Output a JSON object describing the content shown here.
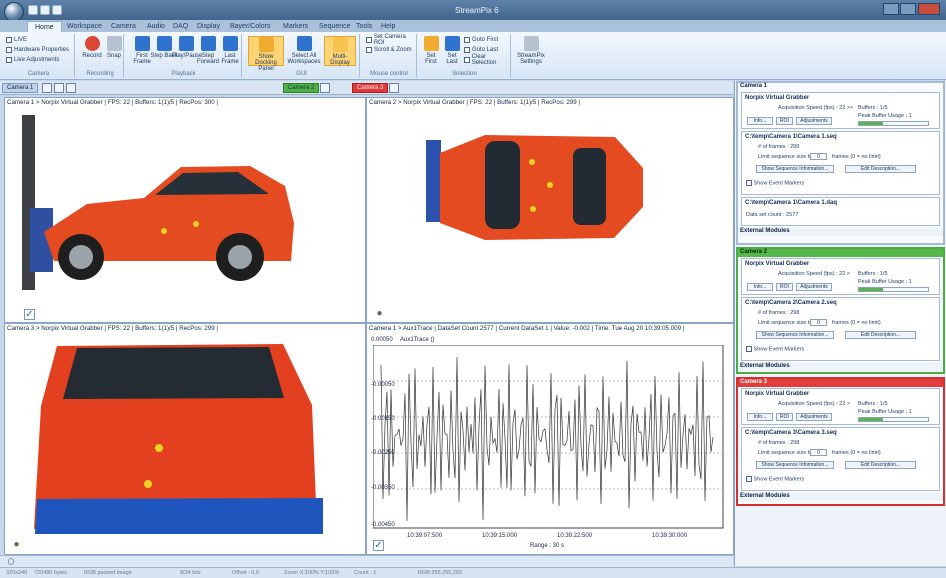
{
  "window": {
    "title": "StreamPix 6"
  },
  "tabs": [
    "Home",
    "Workspace",
    "Camera",
    "Audio",
    "DAQ",
    "Display",
    "Bayer/Colors",
    "Markers",
    "Sequence",
    "Tools",
    "Help"
  ],
  "ribbon": {
    "camera": {
      "label": "Camera",
      "live": "LIVE",
      "hardware": "Hardware Properties",
      "adjust": "Live Adjustments"
    },
    "recording": {
      "label": "Recording",
      "record": "Record",
      "snap": "Snap"
    },
    "playback": {
      "label": "Playback",
      "first": "First Frame",
      "stepback": "Step Back",
      "play": "Play/Pause",
      "stepfwd": "Step Forward",
      "last": "Last Frame"
    },
    "gui": {
      "label": "GUI",
      "docking": "Show Docking Panel",
      "selectall": "Select All Workspaces",
      "multi": "Multi-Display"
    },
    "mouse": {
      "label": "Mouse control",
      "roi": "Set Camera ROI",
      "scroll": "Scroll & Zoom"
    },
    "selection": {
      "label": "Selection",
      "setfirst": "Set First",
      "setlast": "Set Last",
      "gofirst": "Goto First",
      "golast": "Goto Last",
      "clear": "Clear Selection"
    },
    "settings": {
      "label": "StreamPix Settings"
    }
  },
  "tool": {
    "cam1": "Camera 1",
    "cam2": "Camera 2",
    "cam3": "Camera 3"
  },
  "views": {
    "v1": "Camera 1 > Norpix Virtual Grabber | FPS: 22 | Buffers: 1(1)/5 | RecPos: 300 |",
    "v2": "Camera 2 > Norpix Virtual Grabber | FPS: 22 | Buffers: 1(1)/5 | RecPos: 299 |",
    "v3": "Camera 3 > Norpix Virtual Grabber | FPS: 22 | Buffers: 1(1)/5 | RecPos: 299 |",
    "v4": "Camera 1 > Aux1Trace | DataSet Count 2577 | Current DataSet 1 | Value: -0.002 | Time: Tue Aug 20 10:39:05.009 |",
    "plot": {
      "ytop": "0.00050",
      "series": "Aux1Trace ()",
      "ylabels": [
        "-0.00050",
        "-0.00150",
        "-0.00250",
        "-0.00350",
        "-0.00450"
      ],
      "xlabels": [
        "10:39:07:500",
        "10:39:15:000",
        "10:39:22:500",
        "10:39:30:000"
      ],
      "range": "Range : 30 s"
    }
  },
  "panel": {
    "c1": {
      "title": "Camera 1",
      "grabber": "Norpix Virtual Grabber",
      "speed": "Acquisition Speed (fps) : 22 >>",
      "buffers": "Buffers : 1/5",
      "peak": "Peak Buffer Usage : 1",
      "peakfill": 0.35,
      "seq": "C:\\temp\\Camera 1\\Camera 1.seq",
      "frames": "# of frames : 299",
      "limit": "Limit sequence size to:",
      "limitval": "0",
      "limithint": "frames (0 = no limit)",
      "seqinfo": "Show Sequence Information...",
      "edit": "Edit Description...",
      "markers": "Show Event Markers",
      "daq": "C:\\temp\\Camera 1\\Camera 1.daq",
      "dataset": "Data set count : 2577",
      "ext": "External Modules"
    },
    "c2": {
      "title": "Camera 2",
      "grabber": "Norpix Virtual Grabber",
      "speed": "Acquisition Speed (fps) : 22 >",
      "buffers": "Buffers : 1/5",
      "peak": "Peak Buffer Usage : 1",
      "peakfill": 0.35,
      "seq": "C:\\temp\\Camera 2\\Camera 2.seq",
      "frames": "# of frames : 298",
      "limit": "Limit sequence size to:",
      "limitval": "0",
      "limithint": "frames (0 = no limit)",
      "seqinfo": "Show Sequence Information...",
      "edit": "Edit Description...",
      "markers": "Show Event Markers",
      "ext": "External Modules"
    },
    "c3": {
      "title": "Camera 3",
      "grabber": "Norpix Virtual Grabber",
      "speed": "Acquisition Speed (fps) : 22 >",
      "buffers": "Buffers : 1/5",
      "peak": "Peak Buffer Usage : 1",
      "peakfill": 0.35,
      "seq": "C:\\temp\\Camera 3\\Camera 3.seq",
      "frames": "# of frames : 298",
      "limit": "Limit sequence size to:",
      "limitval": "0",
      "limithint": "frames (0 = no limit)",
      "seqinfo": "Show Sequence Information...",
      "edit": "Edit Description...",
      "markers": "Show Event Markers",
      "ext": "External Modules"
    },
    "info": "Info...",
    "roi": "ROI",
    "adjust": "Adjustments"
  },
  "status": [
    "320x240",
    "720480 bytes",
    "RGB packed image",
    "8/24 bits",
    "Offset : 0,0",
    "Zoom X:100% Y:100%",
    "Count : 1",
    "RGB:255,255,255"
  ]
}
